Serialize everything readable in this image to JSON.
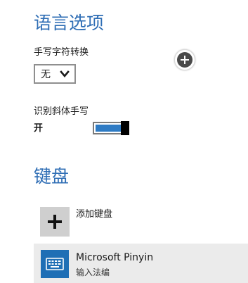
{
  "language_options": {
    "title": "语言选项",
    "handwriting_conversion": {
      "label": "手写字符转换",
      "selected_value": "无"
    },
    "italic_recognition": {
      "label": "识别斜体手写",
      "state_text": "开",
      "on": true
    },
    "add_icon": "plus-circle-icon"
  },
  "keyboard": {
    "title": "键盘",
    "add_keyboard_label": "添加键盘",
    "items": [
      {
        "name": "Microsoft Pinyin",
        "subtitle": "输入法编",
        "icon": "keyboard-icon"
      }
    ]
  },
  "colors": {
    "accent": "#2f6eb5",
    "toggle_fill": "#2e7bc4",
    "keyboard_tile": "#1f6fb5"
  }
}
